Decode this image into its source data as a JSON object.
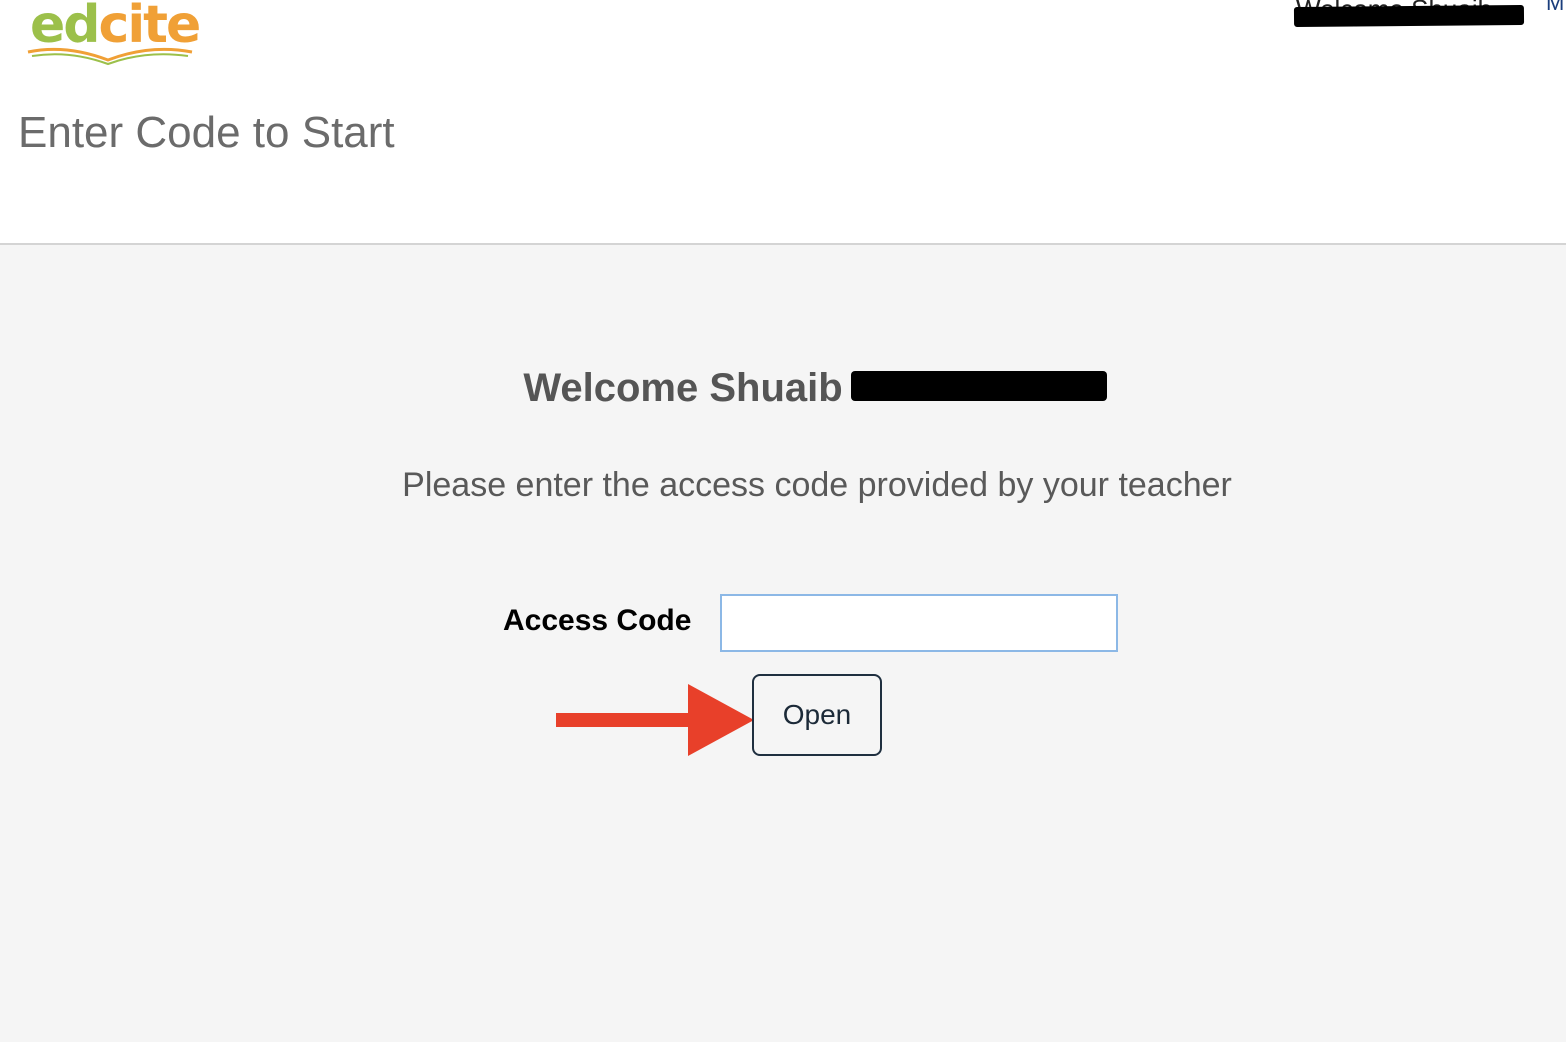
{
  "header": {
    "logo": {
      "text_part1": "ed",
      "text_part2": "cite",
      "color_primary": "#9cc04a",
      "color_secondary": "#f0a036"
    },
    "top_right_welcome": "Welcome Shuaib",
    "menu_link": "M",
    "page_title": "Enter Code to Start"
  },
  "main": {
    "welcome_prefix": "Welcome Shuaib",
    "instructions": "Please enter the access code provided by your teacher",
    "access_code_label": "Access Code",
    "access_code_value": "",
    "open_button_label": "Open"
  },
  "annotation": {
    "arrow_color": "#e8402a"
  }
}
